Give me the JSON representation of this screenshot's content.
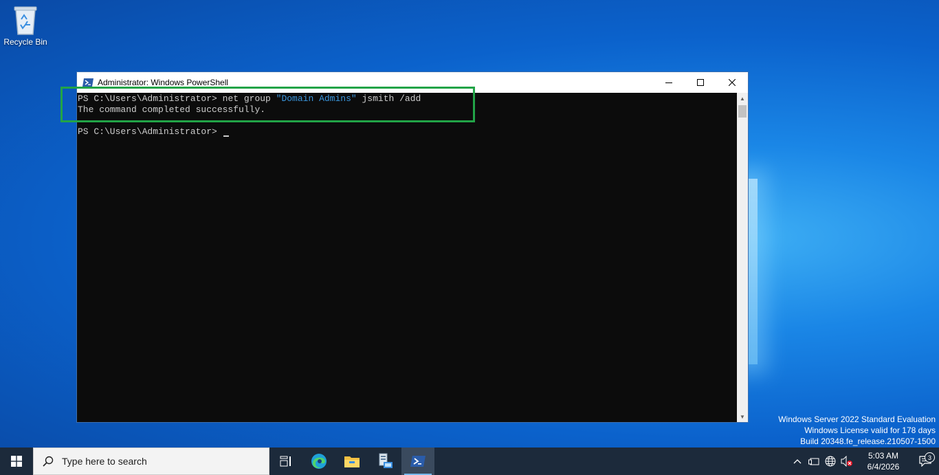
{
  "desktop": {
    "recycle_bin_label": "Recycle Bin",
    "watermark": {
      "line1": "Windows Server 2022 Standard Evaluation",
      "line2": "Windows License valid for 178 days",
      "line3": "Build 20348.fe_release.210507-1500"
    }
  },
  "window": {
    "title": "Administrator: Windows PowerShell",
    "console": {
      "prompt1": "PS C:\\Users\\Administrator> ",
      "cmd_part1": "net group ",
      "cmd_string": "\"Domain Admins\"",
      "cmd_part2": " jsmith /add",
      "output": "The command completed successfully.",
      "prompt2": "PS C:\\Users\\Administrator> "
    },
    "colors": {
      "highlight_box": "#22a447",
      "string_token": "#3a96dd"
    }
  },
  "taskbar": {
    "search_placeholder": "Type here to search",
    "items": [
      "task-view-icon",
      "edge-icon",
      "file-explorer-icon",
      "server-manager-icon",
      "powershell-icon"
    ],
    "clock": {
      "time": "5:03 AM",
      "date": "6/4/2026"
    },
    "notification_count": "3"
  }
}
